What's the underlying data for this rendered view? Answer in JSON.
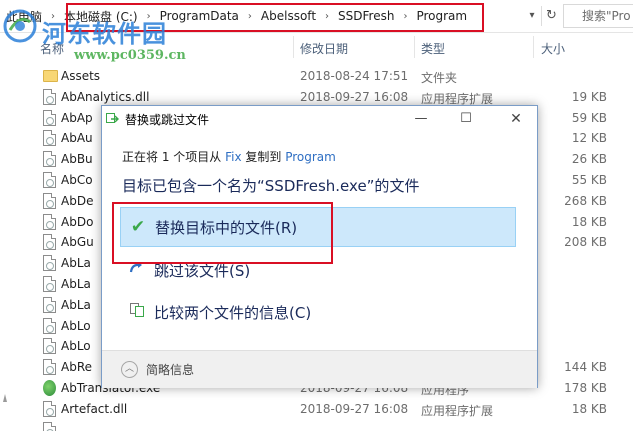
{
  "breadcrumb": {
    "items": [
      "此电脑",
      "本地磁盘 (C:)",
      "ProgramData",
      "Abelssoft",
      "SSDFresh",
      "Program"
    ]
  },
  "search": {
    "placeholder": "搜索\"Pro"
  },
  "columns": {
    "name": "名称",
    "modified": "修改日期",
    "type": "类型",
    "size": "大小"
  },
  "watermark": {
    "title": "河东软件园",
    "url": "www.pc0359.cn"
  },
  "files": [
    {
      "name": "Assets",
      "date": "2018-08-24 17:51",
      "type": "文件夹",
      "size": "",
      "icon": "folder-icon"
    },
    {
      "name": "AbAnalytics.dll",
      "date": "2018-09-27 16:08",
      "type": "应用程序扩展",
      "size": "19 KB",
      "icon": "dll-icon"
    },
    {
      "name": "AbAp",
      "date": "",
      "type": "",
      "size": "59 KB",
      "icon": "dll-icon"
    },
    {
      "name": "AbAu",
      "date": "",
      "type": "",
      "size": "12 KB",
      "icon": "dll-icon"
    },
    {
      "name": "AbBu",
      "date": "",
      "type": "",
      "size": "26 KB",
      "icon": "dll-icon"
    },
    {
      "name": "AbCo",
      "date": "",
      "type": "",
      "size": "55 KB",
      "icon": "dll-icon"
    },
    {
      "name": "AbDe",
      "date": "",
      "type": "",
      "size": "268 KB",
      "icon": "dll-icon"
    },
    {
      "name": "AbDo",
      "date": "",
      "type": "",
      "size": "18 KB",
      "icon": "dll-icon"
    },
    {
      "name": "AbGu",
      "date": "",
      "type": "",
      "size": "208 KB",
      "icon": "dll-icon"
    },
    {
      "name": "AbLa",
      "date": "",
      "type": "",
      "size": "",
      "icon": "dll-icon"
    },
    {
      "name": "AbLa",
      "date": "",
      "type": "",
      "size": "",
      "icon": "dll-icon"
    },
    {
      "name": "AbLa",
      "date": "",
      "type": "",
      "size": "",
      "icon": "dll-icon"
    },
    {
      "name": "AbLo",
      "date": "",
      "type": "",
      "size": "",
      "icon": "dll-icon"
    },
    {
      "name": "AbLo",
      "date": "",
      "type": "",
      "size": "",
      "icon": "dll-icon"
    },
    {
      "name": "AbRe",
      "date": "",
      "type": "",
      "size": "144 KB",
      "icon": "dll-icon"
    },
    {
      "name": "AbTranslator.exe",
      "date": "2018-09-27 16:08",
      "type": "应用程序",
      "size": "178 KB",
      "icon": "exe-icon"
    },
    {
      "name": "Artefact.dll",
      "date": "2018-09-27 16:08",
      "type": "应用程序扩展",
      "size": "18 KB",
      "icon": "dll-icon"
    },
    {
      "name": "",
      "date": "",
      "type": "",
      "size": "",
      "icon": "dll-icon"
    }
  ],
  "dialog": {
    "title": "替换或跳过文件",
    "progress": {
      "prefix": "正在将 1 个项目从 ",
      "source": "Fix",
      "middle": " 复制到 ",
      "dest": "Program"
    },
    "heading": "目标已包含一个名为“SSDFresh.exe”的文件",
    "options": {
      "replace": "替换目标中的文件(R)",
      "skip": "跳过该文件(S)",
      "compare": "比较两个文件的信息(C)"
    },
    "details": "简略信息"
  },
  "colors": {
    "highlight_red": "#d90f24",
    "option_selected_bg": "#cde8fb",
    "link_blue": "#2f6fc3",
    "check_green": "#3aa84a"
  }
}
